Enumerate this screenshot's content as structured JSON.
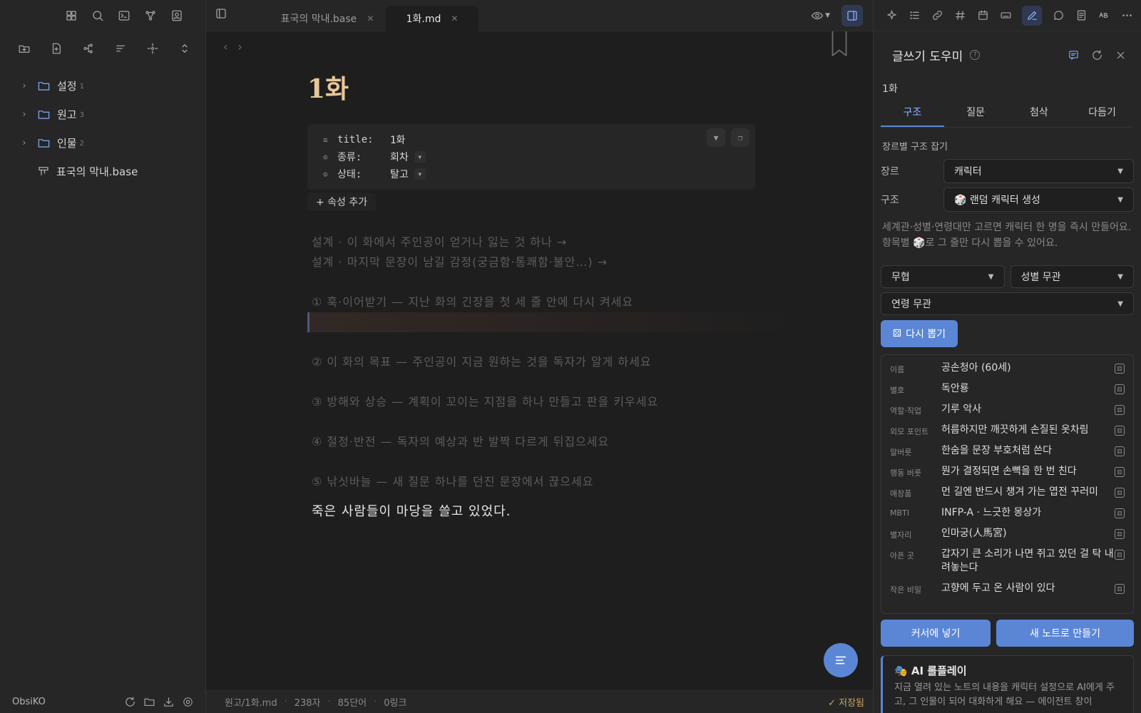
{
  "left_sidebar": {
    "tree": [
      {
        "label": "설정",
        "count": "1",
        "type": "folder"
      },
      {
        "label": "원고",
        "count": "3",
        "type": "folder"
      },
      {
        "label": "인물",
        "count": "2",
        "type": "folder"
      },
      {
        "label": "표국의 막내.base",
        "type": "file"
      }
    ],
    "vault_name": "ObsiKO"
  },
  "tabs": [
    {
      "label": "표국의 막내.base",
      "active": false
    },
    {
      "label": "1화.md",
      "active": true
    }
  ],
  "editor": {
    "title": "1화",
    "properties": [
      {
        "key": "title:",
        "value": "1화",
        "icon": "text-lines-icon",
        "dropdown": false
      },
      {
        "key": "종류:",
        "value": "회차",
        "icon": "select-icon",
        "dropdown": true
      },
      {
        "key": "상태:",
        "value": "탈고",
        "icon": "select-icon",
        "dropdown": true
      }
    ],
    "add_property": "+ 속성 추가",
    "design_hints": [
      "설계 · 이 화에서 주인공이 얻거나 잃는 것 하나 →",
      "설계 · 마지막 문장이 남길 감정(궁금함·통쾌함·불안…) →"
    ],
    "steps": [
      "① 훅·이어받기 — 지난 화의 긴장을 첫 세 줄 안에 다시 켜세요",
      "② 이 화의 목표 — 주인공이 지금 원하는 것을 독자가 알게 하세요",
      "③ 방해와 상승 — 계획이 꼬이는 지점을 하나 만들고 판을 키우세요",
      "④ 절정·반전 — 독자의 예상과 반 발짝 다르게 뒤집으세요",
      "⑤ 낚싯바늘 — 새 질문 하나를 던진 문장에서 끊으세요"
    ],
    "final_line": "죽은 사람들이 마당을 쓸고 있었다."
  },
  "status": {
    "path": "원고/1화.md",
    "chars": "238자",
    "words": "85단어",
    "links": "0링크",
    "saved": "✓ 저장됨"
  },
  "right_panel": {
    "title": "글쓰기 도우미",
    "help": "?",
    "note_name": "1화",
    "tabs": [
      "구조",
      "질문",
      "첨삭",
      "다듬기"
    ],
    "active_tab": "구조",
    "section_label": "장르별 구조 잡기",
    "genre_label": "장르",
    "genre_value": "캐릭터",
    "structure_label": "구조",
    "structure_value": "🎲 랜덤 캐릭터 생성",
    "description": "세계관·성별·연령대만 고르면 캐릭터 한 명을 즉시 만들어요. 항목별 🎲로 그 줄만 다시 뽑을 수 있어요.",
    "filter_world": "무협",
    "filter_gender": "성별 무관",
    "filter_age": "연령 무관",
    "reroll_label": "다시 뽑기",
    "result": [
      {
        "k": "이름",
        "v": "공손청아 (60세)"
      },
      {
        "k": "별호",
        "v": "독안룡"
      },
      {
        "k": "역할·직업",
        "v": "기루 악사"
      },
      {
        "k": "외모 포인트",
        "v": "허름하지만 깨끗하게 손질된 옷차림"
      },
      {
        "k": "말버릇",
        "v": "한숨을 문장 부호처럼 쓴다"
      },
      {
        "k": "행동 버릇",
        "v": "뭔가 결정되면 손뼉을 한 번 친다"
      },
      {
        "k": "애장품",
        "v": "먼 길엔 반드시 챙겨 가는 엽전 꾸러미"
      },
      {
        "k": "MBTI",
        "v": "INFP-A · 느긋한 몽상가"
      },
      {
        "k": "별자리",
        "v": "인마궁(人馬宮)"
      },
      {
        "k": "아픈 곳",
        "v": "갑자기 큰 소리가 나면 쥐고 있던 걸 탁 내려놓는다"
      },
      {
        "k": "작은 비밀",
        "v": "고향에 두고 온 사람이 있다"
      }
    ],
    "insert_label": "커서에 넣기",
    "new_note_label": "새 노트로 만들기",
    "ai_title": "🎭 AI 롤플레이",
    "ai_desc": "지금 열려 있는 노트의 내용을 캐릭터 설정으로 AI에게 주고, 그 인물이 되어 대화하게 해요 — 에이전트 창이"
  },
  "colors": {
    "accent": "#5b86d6",
    "title": "#e8c79a",
    "background": "#1e1e1e",
    "panel": "#262626"
  }
}
